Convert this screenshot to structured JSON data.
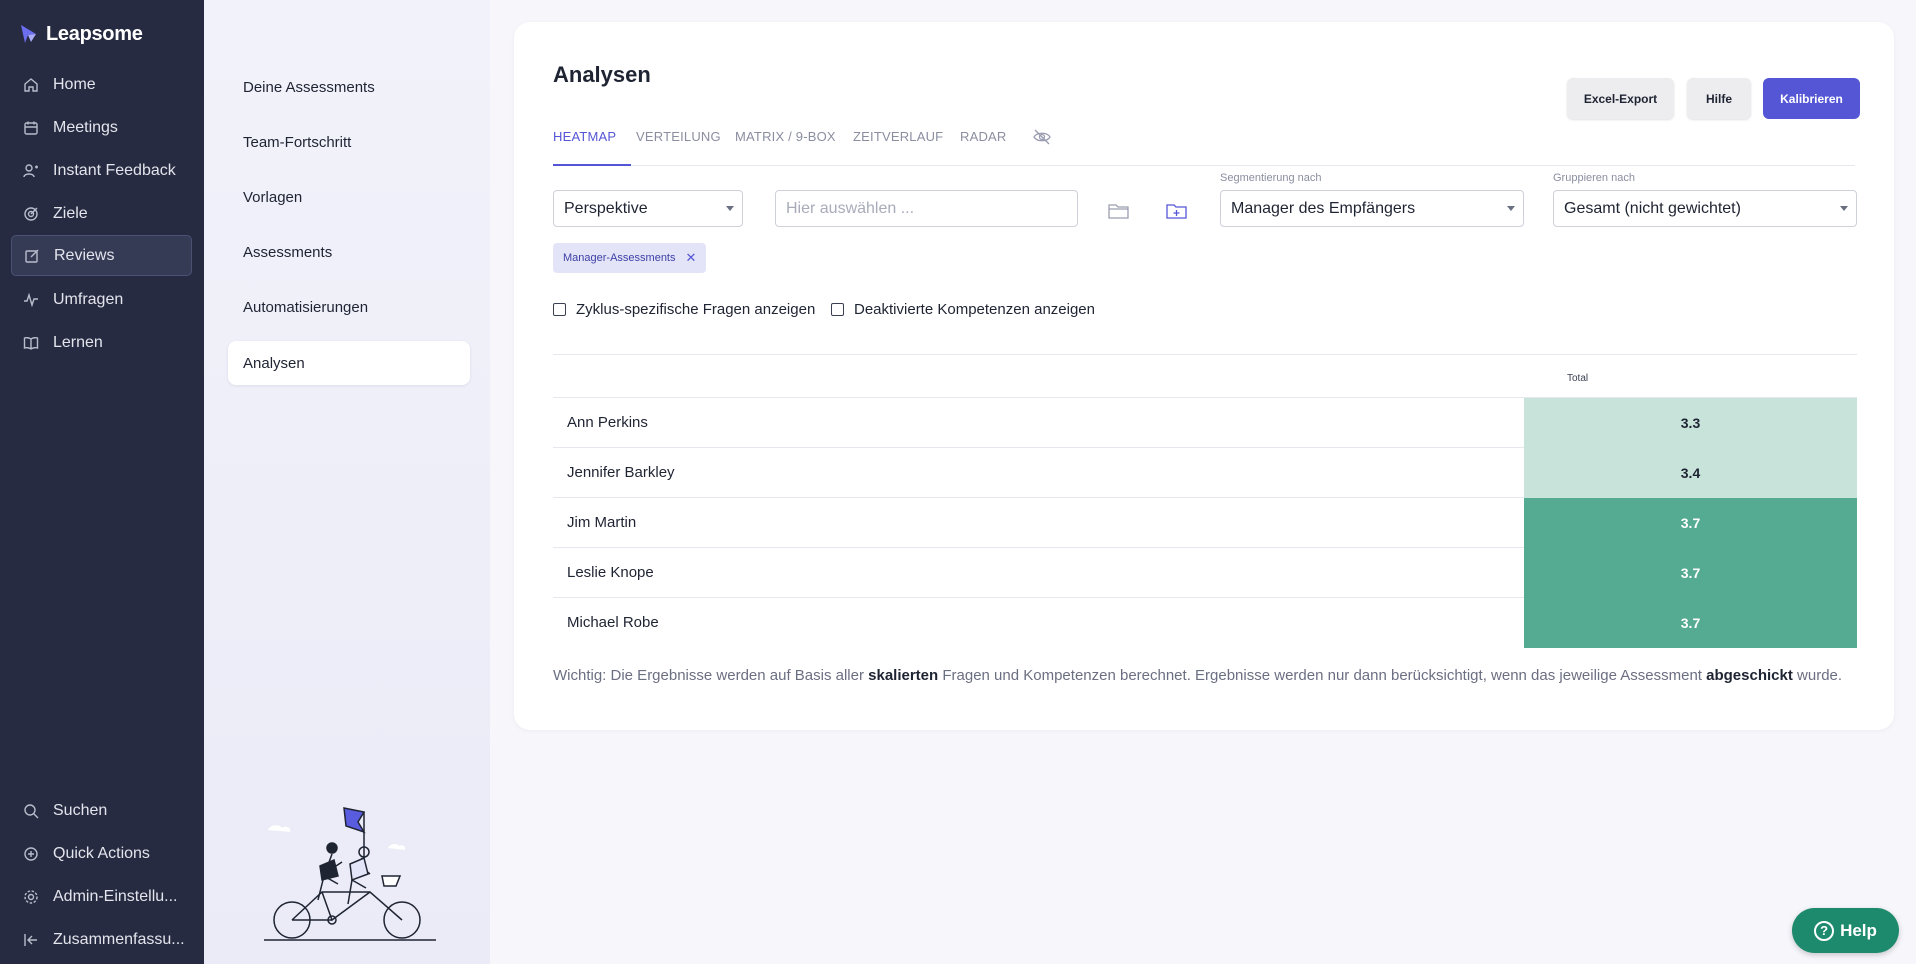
{
  "app": {
    "name": "Leapsome"
  },
  "nav": {
    "items": [
      {
        "label": "Home",
        "icon": "home-icon"
      },
      {
        "label": "Meetings",
        "icon": "meetings-icon"
      },
      {
        "label": "Instant Feedback",
        "icon": "feedback-icon"
      },
      {
        "label": "Ziele",
        "icon": "target-icon"
      },
      {
        "label": "Reviews",
        "icon": "edit-icon",
        "active": true
      },
      {
        "label": "Umfragen",
        "icon": "pulse-icon"
      },
      {
        "label": "Lernen",
        "icon": "book-icon"
      }
    ],
    "bottom": [
      {
        "label": "Suchen",
        "icon": "search-icon"
      },
      {
        "label": "Quick Actions",
        "icon": "plus-circle-icon"
      },
      {
        "label": "Admin-Einstellu...",
        "icon": "gear-icon"
      },
      {
        "label": "Zusammenfassu...",
        "icon": "collapse-icon"
      }
    ]
  },
  "subnav": {
    "items": [
      {
        "label": "Deine Assessments"
      },
      {
        "label": "Team-Fortschritt"
      },
      {
        "label": "Vorlagen"
      },
      {
        "label": "Assessments"
      },
      {
        "label": "Automatisierungen"
      },
      {
        "label": "Analysen",
        "active": true
      }
    ]
  },
  "main": {
    "title": "Analysen",
    "tabs": [
      "HEATMAP",
      "VERTEILUNG",
      "MATRIX / 9-BOX",
      "ZEITVERLAUF",
      "RADAR"
    ],
    "active_tab": "HEATMAP",
    "buttons": {
      "export": "Excel-Export",
      "help": "Hilfe",
      "calibrate": "Kalibrieren"
    },
    "filters": {
      "perspective": "Perspektive",
      "search_placeholder": "Hier auswählen ...",
      "segment_label": "Segmentierung nach",
      "segment_value": "Manager des Empfängers",
      "group_label": "Gruppieren nach",
      "group_value": "Gesamt (nicht gewichtet)"
    },
    "chip": {
      "label": "Manager-Assessments"
    },
    "checkboxes": {
      "cycle_questions": "Zyklus-spezifische Fragen anzeigen",
      "disabled_competencies": "Deaktivierte Kompetenzen anzeigen"
    },
    "table": {
      "header_total": "Total",
      "rows": [
        {
          "name": "Ann Perkins",
          "value": "3.3",
          "level": "light"
        },
        {
          "name": "Jennifer Barkley",
          "value": "3.4",
          "level": "light"
        },
        {
          "name": "Jim Martin",
          "value": "3.7",
          "level": "dark"
        },
        {
          "name": "Leslie Knope",
          "value": "3.7",
          "level": "dark"
        },
        {
          "name": "Michael Robe",
          "value": "3.7",
          "level": "dark"
        }
      ]
    },
    "note": {
      "p1": "Wichtig: Die Ergebnisse werden auf Basis aller ",
      "b1": "skalierten",
      "p2": " Fragen und Kompetenzen berechnet. Ergebnisse werden nur dann berücksichtigt, wenn das jeweilige Assessment ",
      "b2": "abgeschickt",
      "p3": " wurde."
    }
  },
  "help_widget": {
    "label": "Help"
  },
  "colors": {
    "accent": "#5456d6",
    "heat_light": "#c7e3da",
    "heat_dark": "#55ab91",
    "nav_bg": "#262b41"
  }
}
